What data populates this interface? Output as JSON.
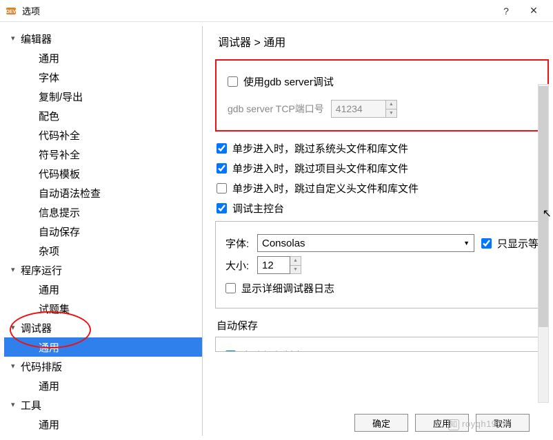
{
  "window": {
    "title": "选项"
  },
  "titlebar": {
    "help": "?",
    "close": "✕"
  },
  "sidebar": {
    "groups": [
      {
        "label": "编辑器",
        "items": [
          "通用",
          "字体",
          "复制/导出",
          "配色",
          "代码补全",
          "符号补全",
          "代码模板",
          "自动语法检查",
          "信息提示",
          "自动保存",
          "杂项"
        ]
      },
      {
        "label": "程序运行",
        "items": [
          "通用",
          "试题集"
        ]
      },
      {
        "label": "调试器",
        "items": [
          "通用"
        ]
      },
      {
        "label": "代码排版",
        "items": [
          "通用"
        ]
      },
      {
        "label": "工具",
        "items": [
          "通用"
        ]
      }
    ],
    "selected": "调试器/通用"
  },
  "breadcrumb": {
    "path": "调试器 > 通用"
  },
  "settings": {
    "gdb": {
      "enable_label": "使用gdb server调试",
      "enable_checked": false,
      "port_label": "gdb server TCP端口号",
      "port_value": "41234"
    },
    "step": {
      "sys_label": "单步进入时，跳过系统头文件和库文件",
      "sys_checked": true,
      "proj_label": "单步进入时，跳过项目头文件和库文件",
      "proj_checked": true,
      "user_label": "单步进入时，跳过自定义头文件和库文件",
      "user_checked": false
    },
    "console": {
      "enable_label": "调试主控台",
      "enable_checked": true,
      "font_label": "字体:",
      "font_value": "Consolas",
      "size_label": "大小:",
      "size_value": "12",
      "only_show_label": "只显示等",
      "only_show_checked": true,
      "verbose_label": "显示详细调试器日志",
      "verbose_checked": false
    },
    "autosave": {
      "header": "自动保存",
      "partial_item": "自动保存断点"
    }
  },
  "buttons": {
    "ok": "确定",
    "apply": "应用",
    "cancel": "取消"
  },
  "watermark": {
    "text": "royqh1979"
  }
}
